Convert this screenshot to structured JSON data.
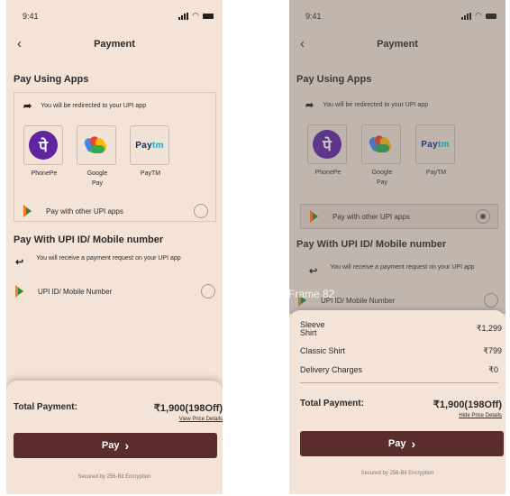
{
  "status": {
    "time": "9:41"
  },
  "header": {
    "title": "Payment",
    "back_glyph": "‹"
  },
  "pay_using_apps": {
    "title": "Pay Using Apps",
    "redirect_note": "You will be redirected to your UPI app",
    "apps": [
      {
        "name": "PhonePe",
        "logo": "पे"
      },
      {
        "name_line1": "Google",
        "name_line2": "Pay"
      },
      {
        "name": "PayTM",
        "logo_part1": "Pay",
        "logo_part2": "tm"
      }
    ],
    "other_label": "Pay with other UPI apps"
  },
  "upi_section": {
    "title": "Pay With UPI ID/ Mobile number",
    "info": "You will receive a payment request on your UPI app",
    "field_label": "UPI ID/ Mobile Number"
  },
  "summary": {
    "total_label": "Total Payment:",
    "total_value": "₹1,900(198Off)",
    "view_details": "View Price Details",
    "hide_details": "Hide Price Details",
    "pay_label": "Pay",
    "pay_chevron": "›",
    "secured": "Secured by 256-Bit Encryption"
  },
  "details": {
    "frame_label": "Frame 82",
    "items": [
      {
        "name_line1": "Sleeve",
        "name_line2": "Shirt",
        "value": "₹1,299"
      },
      {
        "name": "Classic Shirt",
        "value": "₹799"
      },
      {
        "name": "Delivery  Charges",
        "value": "₹0"
      }
    ]
  },
  "colors": {
    "background": "#f4e3d7",
    "pay_button": "#5a2c2c",
    "phonepe": "#5f259f"
  }
}
